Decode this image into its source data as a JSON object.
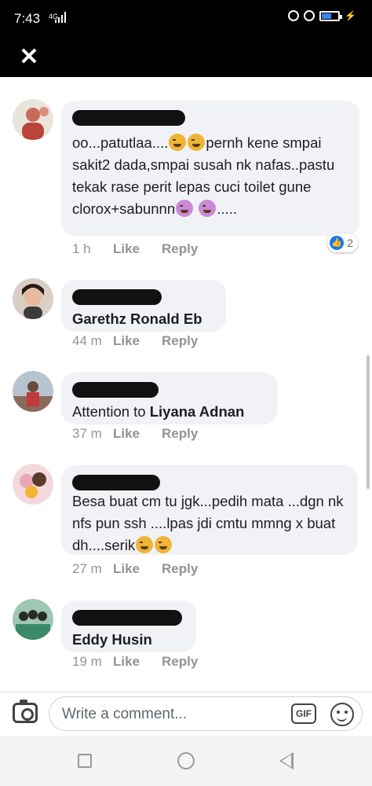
{
  "status_bar": {
    "time": "7:43",
    "network": "4G",
    "icons": [
      "signal-icon",
      "alarm-icon",
      "clock-icon",
      "battery-icon",
      "charging-icon"
    ]
  },
  "header": {
    "close_icon": "close-icon"
  },
  "comments": [
    {
      "text_before": "oo...patutlaa....",
      "text_mid": "pernh kene smpai sakit2 dada,smpai susah nk nafas..pastu tekak rase perit lepas cuci toilet gune clorox+sabunnn",
      "text_after": ".....",
      "time": "1 h",
      "like": "Like",
      "reply": "Reply",
      "reaction_count": "2"
    },
    {
      "text_plain": "",
      "name": "Garethz Ronald Eb",
      "time": "44 m",
      "like": "Like",
      "reply": "Reply"
    },
    {
      "text_plain": "Attention to ",
      "name": "Liyana Adnan",
      "time": "37 m",
      "like": "Like",
      "reply": "Reply"
    },
    {
      "text_before": "Besa buat cm tu jgk...pedih mata ...dgn nk nfs pun ssh ....lpas jdi cmtu mmng x buat dh....serik",
      "time": "27 m",
      "like": "Like",
      "reply": "Reply"
    },
    {
      "text_plain": "",
      "name": "Eddy Husin",
      "time": "19 m",
      "like": "Like",
      "reply": "Reply"
    }
  ],
  "composer": {
    "placeholder": "Write a comment...",
    "gif_label": "GIF"
  },
  "colors": {
    "bubble": "#f0f2f5",
    "meta": "#909398",
    "reaction_blue": "#1877f2"
  }
}
